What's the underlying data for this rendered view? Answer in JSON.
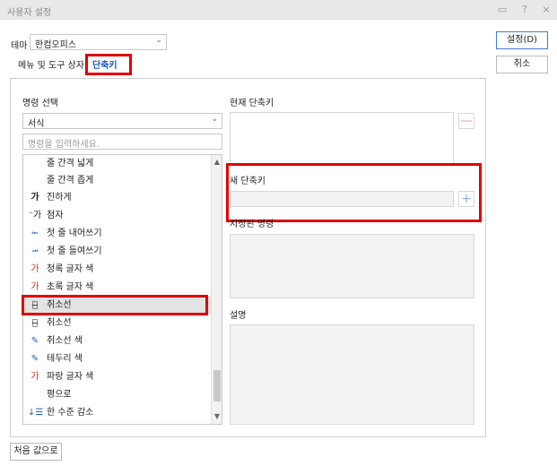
{
  "title_bar": {
    "title": "사용자 설정",
    "icons": [
      "restore-icon",
      "help-icon",
      "close-icon"
    ],
    "help_glyph": "?",
    "close_glyph": "×"
  },
  "theme": {
    "label": "테마",
    "selected": "한컴오피스"
  },
  "tabs": [
    {
      "label": "메뉴 및 도구 상자"
    },
    {
      "label": "단축키"
    }
  ],
  "buttons": {
    "confirm": "설정(D)",
    "cancel": "취소",
    "reset": "처음 값으로"
  },
  "command_select": {
    "label": "명령 선택",
    "category": "서식",
    "search_placeholder": "명령을 입력하세요.",
    "items": [
      {
        "icon": "",
        "label": "줄 간격 넓게"
      },
      {
        "icon": "",
        "label": "줄 간격 좁게"
      },
      {
        "icon": "가",
        "label": "진하게"
      },
      {
        "icon": "⁻가",
        "label": "첨자"
      },
      {
        "icon": "⭰",
        "label": "첫 줄 내어쓰기"
      },
      {
        "icon": "⭲",
        "label": "첫 줄 들여쓰기"
      },
      {
        "icon": "가",
        "label": "청록 글자 색"
      },
      {
        "icon": "가",
        "label": "초록 글자 색"
      },
      {
        "icon": "가̶",
        "label": "취소선"
      },
      {
        "icon": "가̶",
        "label": "취소선"
      },
      {
        "icon": "✎",
        "label": "취소선 색"
      },
      {
        "icon": "✎",
        "label": "테두리 색"
      },
      {
        "icon": "가",
        "label": "파랑 글자 색"
      },
      {
        "icon": "",
        "label": "평으로"
      },
      {
        "icon": "↓☰",
        "label": "한 수준 감소"
      }
    ],
    "selected_index": 8
  },
  "right": {
    "current_label": "현재 단축키",
    "new_label": "새 단축키",
    "assigned_label": "지정된 명령",
    "desc_label": "설명",
    "remove_glyph": "—",
    "add_glyph": "+"
  },
  "colors": {
    "accent": "#1a56c8",
    "highlight": "#e00000",
    "icon_red": "#d03020",
    "icon_blue": "#2060c0"
  }
}
